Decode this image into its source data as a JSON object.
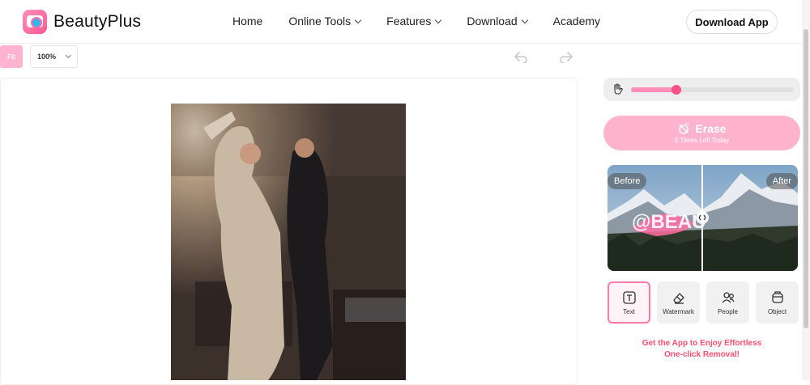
{
  "header": {
    "brand": "BeautyPlus",
    "nav": [
      {
        "label": "Home",
        "has_dropdown": false
      },
      {
        "label": "Online Tools",
        "has_dropdown": true
      },
      {
        "label": "Features",
        "has_dropdown": true
      },
      {
        "label": "Download",
        "has_dropdown": true
      },
      {
        "label": "Academy",
        "has_dropdown": false
      }
    ],
    "download_app": "Download App"
  },
  "toolbar": {
    "fit": "Fit",
    "zoom": "100%"
  },
  "panel": {
    "brush_level": 0.28,
    "erase": {
      "label": "Erase",
      "subtext": "5 Times Left Today"
    },
    "compare": {
      "before": "Before",
      "after": "After",
      "watermark": "@BEAU"
    },
    "tools": [
      {
        "label": "Text",
        "icon": "text-icon",
        "active": true
      },
      {
        "label": "Watermark",
        "icon": "eraser-icon",
        "active": false
      },
      {
        "label": "People",
        "icon": "people-icon",
        "active": false
      },
      {
        "label": "Object",
        "icon": "object-icon",
        "active": false
      }
    ],
    "promo_line1": "Get the App to Enjoy Effortless",
    "promo_line2": "One-click Removal!"
  },
  "colors": {
    "accent": "#ff4f8b",
    "accent_light": "#ffb3cd",
    "promo": "#ff4f6f"
  }
}
